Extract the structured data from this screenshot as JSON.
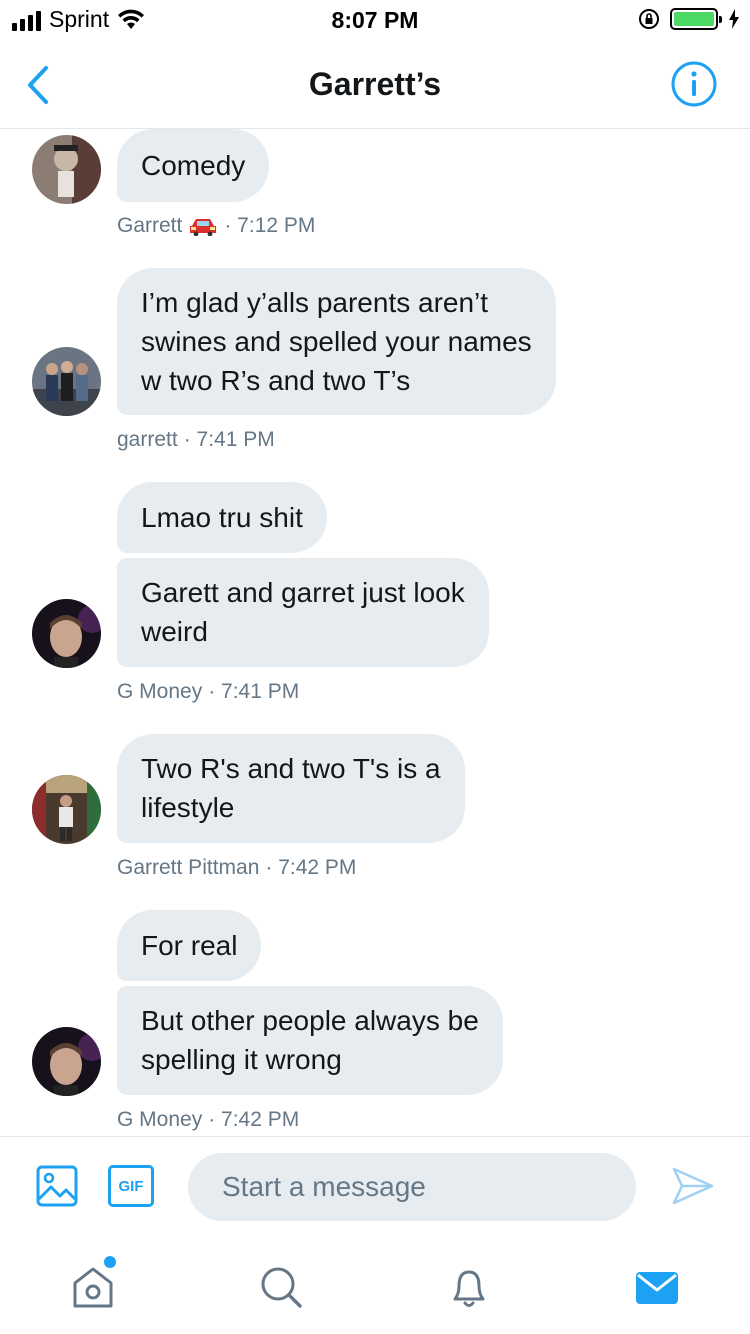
{
  "status_bar": {
    "carrier": "Sprint",
    "time": "8:07 PM",
    "battery_level": 1.0
  },
  "nav": {
    "title": "Garrett’s",
    "back_icon": "chevron-left-icon",
    "info_icon": "info-icon"
  },
  "messages": [
    {
      "text_lines": [
        "Comedy"
      ],
      "sender": "Garrett",
      "sender_emoji": "car-emoji",
      "time": "· 7:12 PM"
    },
    {
      "text_lines": [
        "I’m glad y’alls parents aren’t",
        "swines and spelled your names",
        "w two R’s and two T’s"
      ],
      "sender": "garrett",
      "time": "· 7:41 PM"
    },
    {
      "text_lines": [
        "Lmao tru shit"
      ]
    },
    {
      "text_lines": [
        "Garett and garret just look",
        "weird"
      ],
      "sender": "G Money",
      "time": "· 7:41 PM"
    },
    {
      "text_lines": [
        "Two R's and two T's is a",
        "lifestyle"
      ],
      "sender": "Garrett Pittman",
      "time": "· 7:42 PM"
    },
    {
      "text_lines": [
        "For real"
      ]
    },
    {
      "text_lines": [
        "But other people always be",
        "spelling it wrong"
      ],
      "sender": "G Money",
      "time": "· 7:42 PM"
    }
  ],
  "composer": {
    "placeholder": "Start a message",
    "gif_label": "GIF",
    "media_icon": "image-icon",
    "send_icon": "send-icon"
  },
  "tab_bar": {
    "tabs": [
      "home-icon",
      "search-icon",
      "bell-icon",
      "mail-icon"
    ],
    "accent_color": "#1da1f2"
  }
}
